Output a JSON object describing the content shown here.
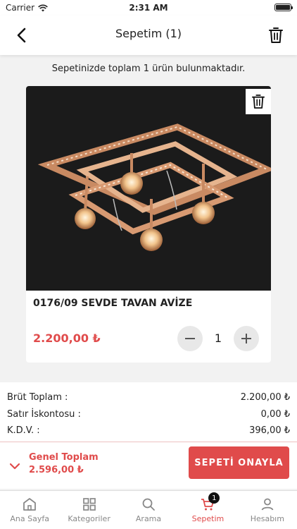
{
  "status_bar": {
    "carrier": "Carrier",
    "time": "2:31 AM"
  },
  "nav": {
    "title": "Sepetim (1)"
  },
  "cart_summary": "Sepetinizde toplam 1 ürün bulunmaktadır.",
  "product": {
    "name": "0176/09 SEVDE TAVAN AVİZE",
    "price": "2.200,00 ₺",
    "quantity": "1"
  },
  "totals": {
    "brut_label": "Brüt Toplam :",
    "brut_value": "2.200,00 ₺",
    "discount_label": "Satır İskontosu :",
    "discount_value": "0,00 ₺",
    "kdv_label": "K.D.V. :",
    "kdv_value": "396,00 ₺"
  },
  "checkout": {
    "grand_label": "Genel Toplam",
    "grand_value": "2.596,00 ₺",
    "confirm_label": "SEPETİ ONAYLA"
  },
  "tabs": [
    {
      "label": "Ana Sayfa",
      "icon": "home-icon"
    },
    {
      "label": "Kategoriler",
      "icon": "grid-icon"
    },
    {
      "label": "Arama",
      "icon": "search-icon"
    },
    {
      "label": "Sepetim",
      "icon": "cart-icon",
      "badge": "1",
      "active": true
    },
    {
      "label": "Hesabım",
      "icon": "user-icon"
    }
  ],
  "colors": {
    "accent": "#e04b4b",
    "badge": "#111111"
  }
}
